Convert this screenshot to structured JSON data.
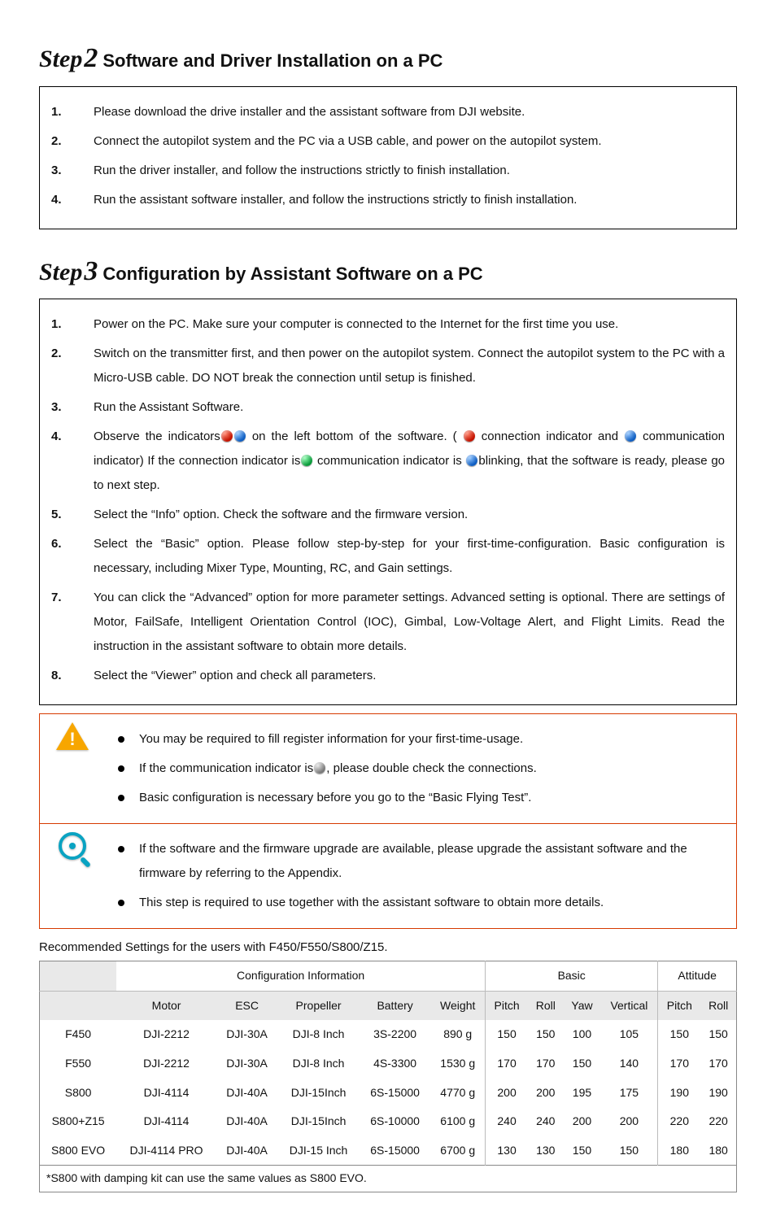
{
  "step2": {
    "label_script": "Step",
    "label_num": "2",
    "title": "Software and Driver Installation on a PC",
    "items": [
      "Please download the drive installer and the assistant software from DJI website.",
      "Connect the autopilot system and the PC via a USB cable, and power on the autopilot system.",
      "Run the driver installer, and follow the instructions strictly to finish installation.",
      "Run the assistant software installer, and follow the instructions strictly to finish installation."
    ]
  },
  "step3": {
    "label_script": "Step",
    "label_num": "3",
    "title": "Configuration by Assistant Software on a PC",
    "items": [
      "Power on the PC. Make sure your computer is connected to the Internet for the first time you use.",
      "Switch on the transmitter first, and then power on the autopilot system. Connect the autopilot system to the PC with a Micro-USB cable. DO NOT break the connection until setup is finished.",
      "Run the Assistant Software.",
      {
        "pre": "Observe the indicators",
        "mid1": " on the left bottom of the software. ( ",
        "mid2": " connection indicator and ",
        "mid3": " communication indicator) If the connection indicator is",
        "mid4": " communication indicator is ",
        "post": "blinking, that the software is ready, please go to next step."
      },
      "Select the “Info” option. Check the software and the firmware version.",
      "Select the “Basic” option. Please follow step-by-step for your first-time-configuration. Basic configuration is necessary, including Mixer Type, Mounting, RC, and Gain settings.",
      "You can click the “Advanced” option for more parameter settings. Advanced setting is optional. There are settings of Motor, FailSafe, Intelligent Orientation Control (IOC), Gimbal, Low-Voltage Alert, and Flight Limits. Read the instruction in the assistant software to obtain more details.",
      "Select the “Viewer” option and check all parameters."
    ]
  },
  "notes": {
    "warn": [
      "You may be required to fill register information for your first-time-usage.",
      {
        "pre": "If the communication indicator is",
        "post": ", please double check the connections."
      },
      "Basic configuration is necessary before you go to the “Basic Flying Test”."
    ],
    "info": [
      "If the software and the firmware upgrade are available, please upgrade the assistant software and the firmware by referring to the Appendix.",
      "This step is required to use together with the assistant software to obtain more details."
    ]
  },
  "table_intro": "Recommended Settings for the users with F450/F550/S800/Z15.",
  "table": {
    "group_headers": [
      "",
      "Configuration Information",
      "Basic",
      "Attitude"
    ],
    "col_headers": [
      "",
      "Motor",
      "ESC",
      "Propeller",
      "Battery",
      "Weight",
      "Pitch",
      "Roll",
      "Yaw",
      "Vertical",
      "Pitch",
      "Roll"
    ],
    "rows": [
      [
        "F450",
        "DJI-2212",
        "DJI-30A",
        "DJI-8 Inch",
        "3S-2200",
        "890 g",
        "150",
        "150",
        "100",
        "105",
        "150",
        "150"
      ],
      [
        "F550",
        "DJI-2212",
        "DJI-30A",
        "DJI-8 Inch",
        "4S-3300",
        "1530 g",
        "170",
        "170",
        "150",
        "140",
        "170",
        "170"
      ],
      [
        "S800",
        "DJI-4114",
        "DJI-40A",
        "DJI-15Inch",
        "6S-15000",
        "4770 g",
        "200",
        "200",
        "195",
        "175",
        "190",
        "190"
      ],
      [
        "S800+Z15",
        "DJI-4114",
        "DJI-40A",
        "DJI-15Inch",
        "6S-10000",
        "6100 g",
        "240",
        "240",
        "200",
        "200",
        "220",
        "220"
      ],
      [
        "S800 EVO",
        "DJI-4114 PRO",
        "DJI-40A",
        "DJI-15 Inch",
        "6S-15000",
        "6700 g",
        "130",
        "130",
        "150",
        "150",
        "180",
        "180"
      ]
    ],
    "footnote": "*S800 with damping kit can use the same values as S800 EVO."
  }
}
